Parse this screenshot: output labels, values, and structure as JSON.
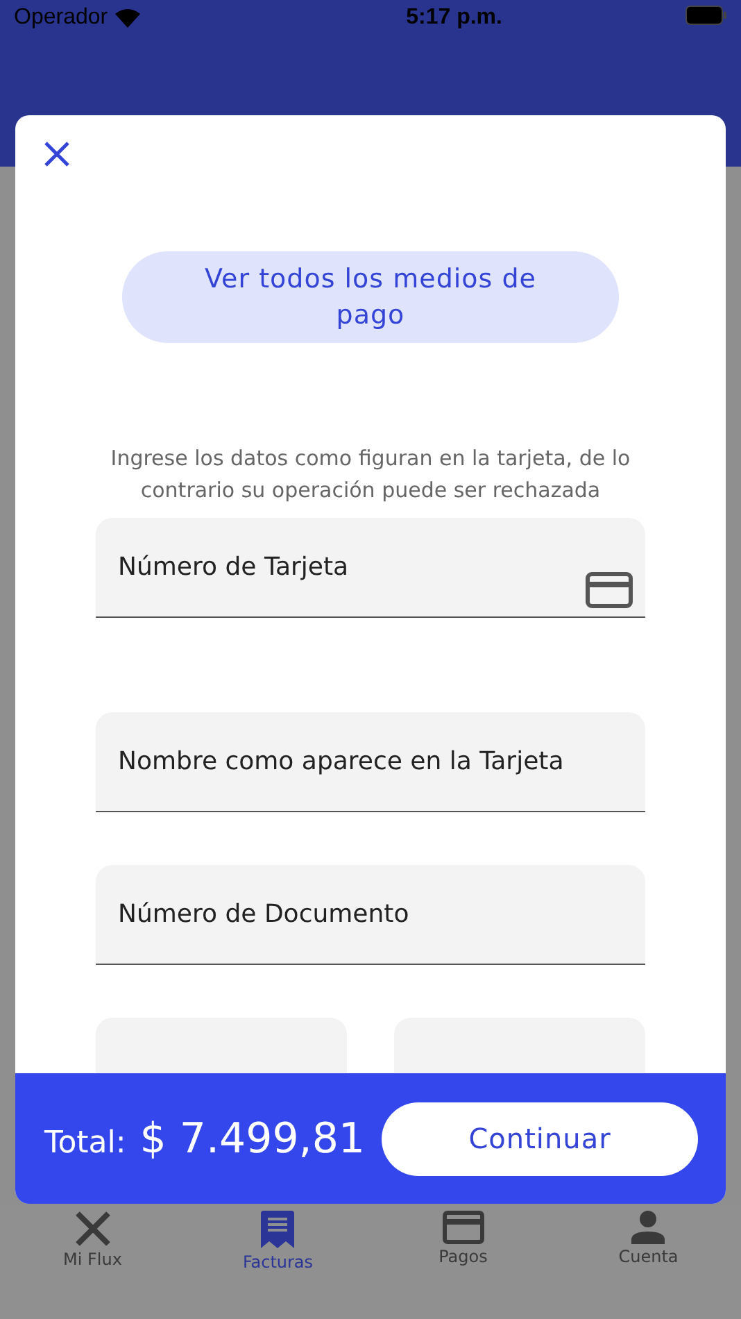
{
  "status_bar": {
    "carrier": "Operador",
    "time": "5:17 p.m."
  },
  "modal": {
    "pay_methods_button": "Ver todos los medios de pago",
    "hint": "Ingrese los datos como figuran en la tarjeta, de lo contrario su operación puede ser rechazada",
    "fields": [
      {
        "placeholder": "Número de Tarjeta",
        "kind": "card"
      },
      {
        "placeholder": "Nombre como aparece en la Tarjeta",
        "kind": "text"
      },
      {
        "placeholder": "Número de Documento",
        "kind": "text"
      }
    ],
    "footer": {
      "total_label": "Total:",
      "total_value": "$ 7.499,81",
      "button": "Continuar"
    }
  },
  "tab_bar": [
    {
      "label": "Mi Flux",
      "kind": "x",
      "selected": false
    },
    {
      "label": "Facturas",
      "kind": "receipt",
      "selected": true
    },
    {
      "label": "Pagos",
      "kind": "card",
      "selected": false
    },
    {
      "label": "Cuenta",
      "kind": "person",
      "selected": false
    }
  ]
}
